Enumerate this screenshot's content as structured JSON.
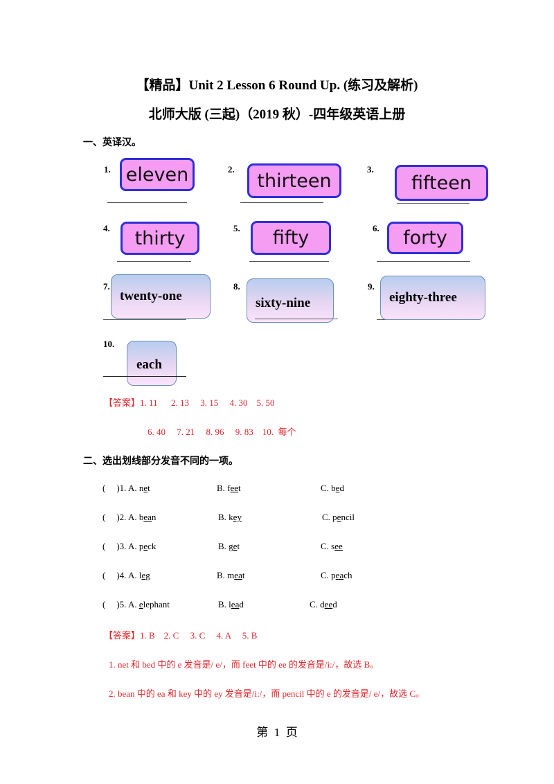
{
  "title": {
    "line1": "【精品】Unit 2 Lesson 6 Round Up. (练习及解析)",
    "line2": "北师大版 (三起)（2019 秋）-四年级英语上册"
  },
  "section1": {
    "heading": "一、英译汉。",
    "items": [
      {
        "num": "1.",
        "word": "eleven"
      },
      {
        "num": "2.",
        "word": "thirteen"
      },
      {
        "num": "3.",
        "word": "fifteen"
      },
      {
        "num": "4.",
        "word": "thirty"
      },
      {
        "num": "5.",
        "word": "fifty"
      },
      {
        "num": "6.",
        "word": "forty"
      },
      {
        "num": "7.",
        "word": "twenty-one"
      },
      {
        "num": "8.",
        "word": "sixty-nine"
      },
      {
        "num": "9.",
        "word": "eighty-three"
      },
      {
        "num": "10.",
        "word": "each"
      }
    ],
    "answer_line1": "【答案】1. 11      2. 13     3. 15     4. 30    5. 50",
    "answer_line2": "6. 40     7. 21     8. 96     9. 83    10.  每个"
  },
  "section2": {
    "heading": "二、选出划线部分发音不同的一项。",
    "questions": [
      {
        "num": ")1. A. ",
        "a_pre": "n",
        "a_ul": "e",
        "a_post": "t",
        "b_pre": "B. f",
        "b_ul": "ee",
        "b_post": "t",
        "c_pre": "C. b",
        "c_ul": "e",
        "c_post": "d"
      },
      {
        "num": ")2. A. ",
        "a_pre": "b",
        "a_ul": "ea",
        "a_post": "n",
        "b_pre": "B. k",
        "b_ul": "ey",
        "b_post": "",
        "c_pre": "C. p",
        "c_ul": "e",
        "c_post": "ncil"
      },
      {
        "num": ")3. A. ",
        "a_pre": "p",
        "a_ul": "e",
        "a_post": "ck",
        "b_pre": "B. g",
        "b_ul": "e",
        "b_post": "t",
        "c_pre": "C. s",
        "c_ul": "ee",
        "c_post": ""
      },
      {
        "num": ")4. A. ",
        "a_pre": "l",
        "a_ul": "e",
        "a_post": "g",
        "b_pre": "B. m",
        "b_ul": "ea",
        "b_post": "t",
        "c_pre": "C. p",
        "c_ul": "ea",
        "c_post": "ch"
      },
      {
        "num": ")5. A. ",
        "a_pre": "",
        "a_ul": "e",
        "a_post": "lephant",
        "b_pre": "B. l",
        "b_ul": "ea",
        "b_post": "d",
        "c_pre": "C. d",
        "c_ul": "ee",
        "c_post": "d"
      }
    ],
    "paren_open": "(",
    "answer": "【答案】1. B    2. C     3. C     4. A     5. B",
    "explain1": "1. net 和 bed 中的 e 发音是/ e/，而 feet 中的 ee 的发音是/i:/，故选 B。",
    "explain2": "2. bean 中的 ea 和 key 中的 ey 发音是/i:/，而 pencil 中的 e 的发音是/ e/，故选 C。"
  },
  "footer": {
    "page_label": "第  1  页"
  }
}
